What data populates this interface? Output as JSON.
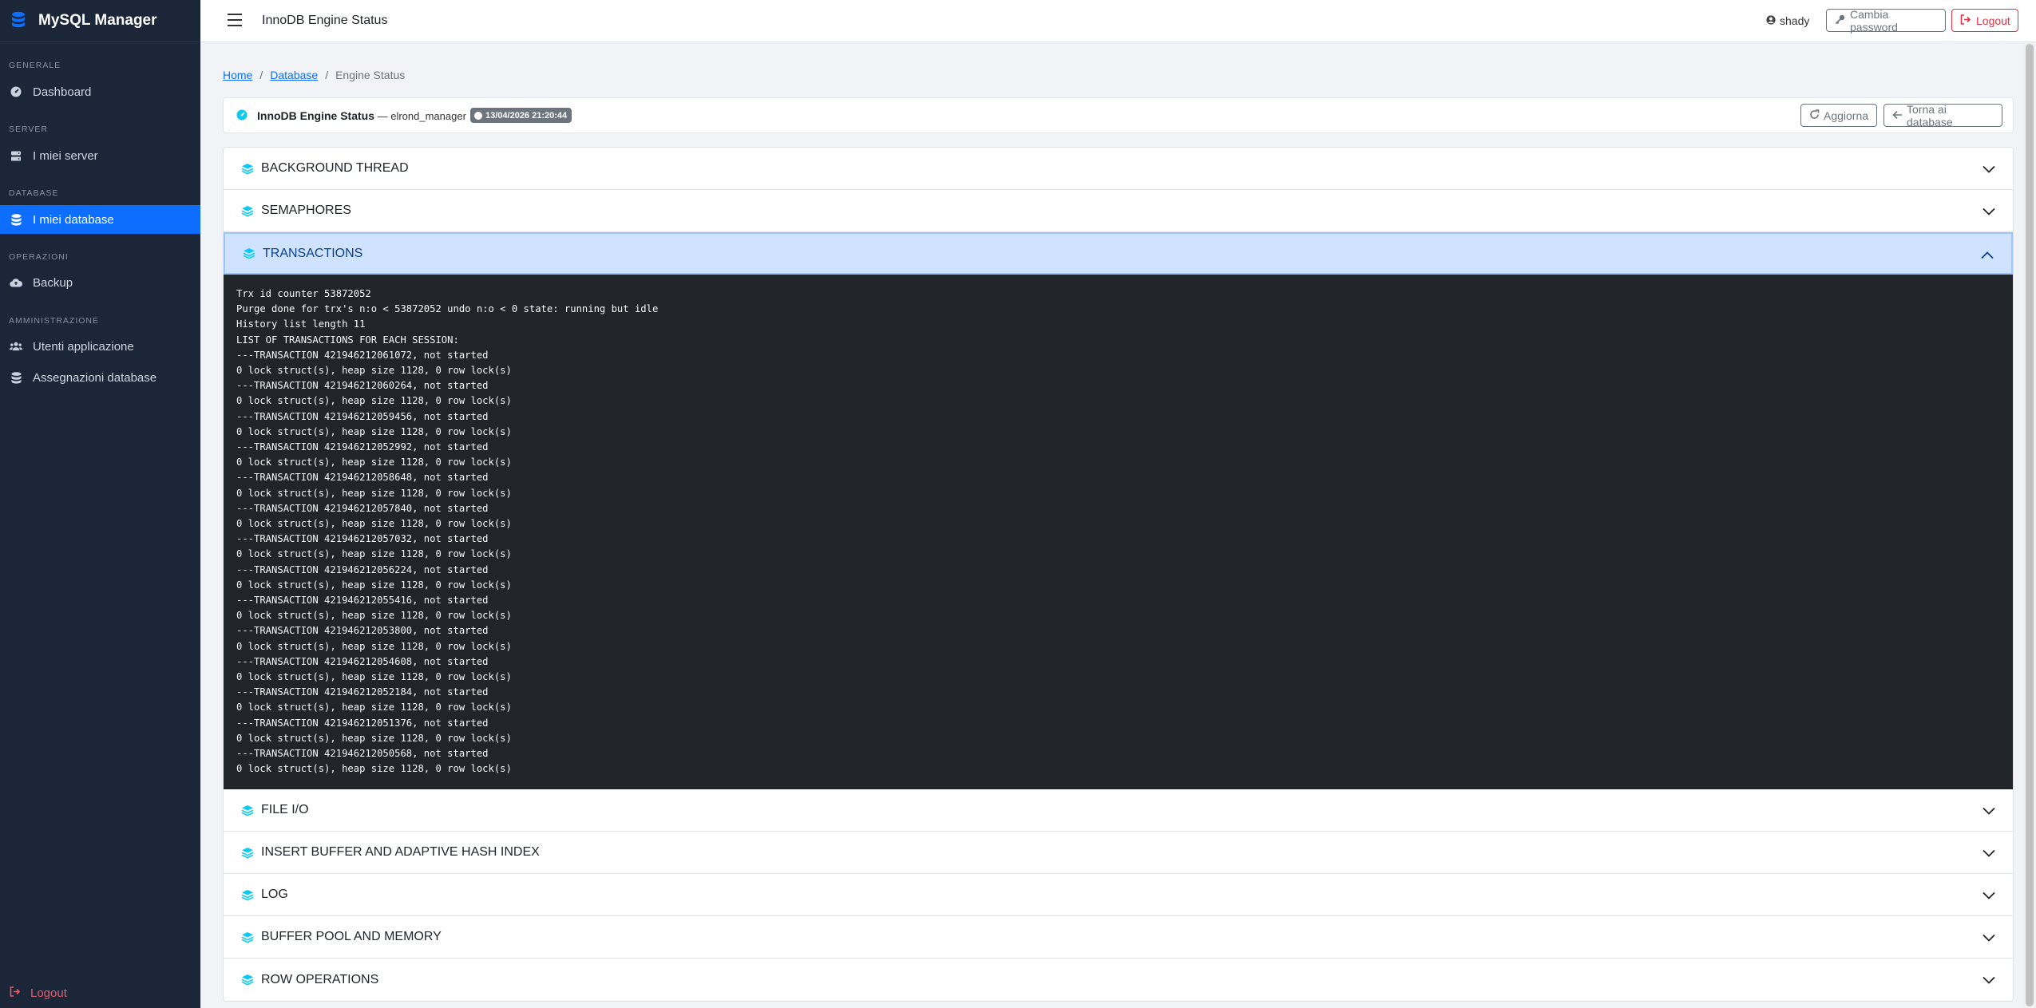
{
  "app": {
    "brand": "MySQL Manager"
  },
  "sidebar": {
    "sections": [
      {
        "label": "GENERALE"
      },
      {
        "label": "SERVER"
      },
      {
        "label": "DATABASE"
      },
      {
        "label": "OPERAZIONI"
      },
      {
        "label": "AMMINISTRAZIONE"
      }
    ],
    "items": [
      {
        "label": "Dashboard",
        "icon": "gauge-icon"
      },
      {
        "label": "I miei server",
        "icon": "server-icon"
      },
      {
        "label": "I miei database",
        "icon": "database-icon",
        "active": true
      },
      {
        "label": "Backup",
        "icon": "cloud-upload-icon"
      },
      {
        "label": "Utenti applicazione",
        "icon": "users-icon"
      },
      {
        "label": "Assegnazioni database",
        "icon": "database-icon"
      }
    ],
    "logout": "Logout"
  },
  "topbar": {
    "title": "InnoDB Engine Status",
    "user": "shady",
    "change_password": "Cambia password",
    "logout": "Logout"
  },
  "breadcrumb": {
    "home": "Home",
    "database": "Database",
    "current": "Engine Status"
  },
  "header": {
    "title": "InnoDB Engine Status",
    "dash": " — ",
    "db": "elrond_manager",
    "timestamp": "13/04/2026 21:20:44",
    "refresh": "Aggiorna",
    "back": "Torna ai database"
  },
  "colors": {
    "accent": "#0d6efd",
    "sidebar_bg": "#1b2638",
    "danger": "#dc3545",
    "info": "#0dcaf0"
  },
  "sections": [
    {
      "title": "BACKGROUND THREAD",
      "open": false
    },
    {
      "title": "SEMAPHORES",
      "open": false
    },
    {
      "title": "TRANSACTIONS",
      "open": true
    },
    {
      "title": "FILE I/O",
      "open": false
    },
    {
      "title": "INSERT BUFFER AND ADAPTIVE HASH INDEX",
      "open": false
    },
    {
      "title": "LOG",
      "open": false
    },
    {
      "title": "BUFFER POOL AND MEMORY",
      "open": false
    },
    {
      "title": "ROW OPERATIONS",
      "open": false
    }
  ],
  "transactions_text": "Trx id counter 53872052\nPurge done for trx's n:o < 53872052 undo n:o < 0 state: running but idle\nHistory list length 11\nLIST OF TRANSACTIONS FOR EACH SESSION:\n---TRANSACTION 421946212061072, not started\n0 lock struct(s), heap size 1128, 0 row lock(s)\n---TRANSACTION 421946212060264, not started\n0 lock struct(s), heap size 1128, 0 row lock(s)\n---TRANSACTION 421946212059456, not started\n0 lock struct(s), heap size 1128, 0 row lock(s)\n---TRANSACTION 421946212052992, not started\n0 lock struct(s), heap size 1128, 0 row lock(s)\n---TRANSACTION 421946212058648, not started\n0 lock struct(s), heap size 1128, 0 row lock(s)\n---TRANSACTION 421946212057840, not started\n0 lock struct(s), heap size 1128, 0 row lock(s)\n---TRANSACTION 421946212057032, not started\n0 lock struct(s), heap size 1128, 0 row lock(s)\n---TRANSACTION 421946212056224, not started\n0 lock struct(s), heap size 1128, 0 row lock(s)\n---TRANSACTION 421946212055416, not started\n0 lock struct(s), heap size 1128, 0 row lock(s)\n---TRANSACTION 421946212053800, not started\n0 lock struct(s), heap size 1128, 0 row lock(s)\n---TRANSACTION 421946212054608, not started\n0 lock struct(s), heap size 1128, 0 row lock(s)\n---TRANSACTION 421946212052184, not started\n0 lock struct(s), heap size 1128, 0 row lock(s)\n---TRANSACTION 421946212051376, not started\n0 lock struct(s), heap size 1128, 0 row lock(s)\n---TRANSACTION 421946212050568, not started\n0 lock struct(s), heap size 1128, 0 row lock(s)"
}
